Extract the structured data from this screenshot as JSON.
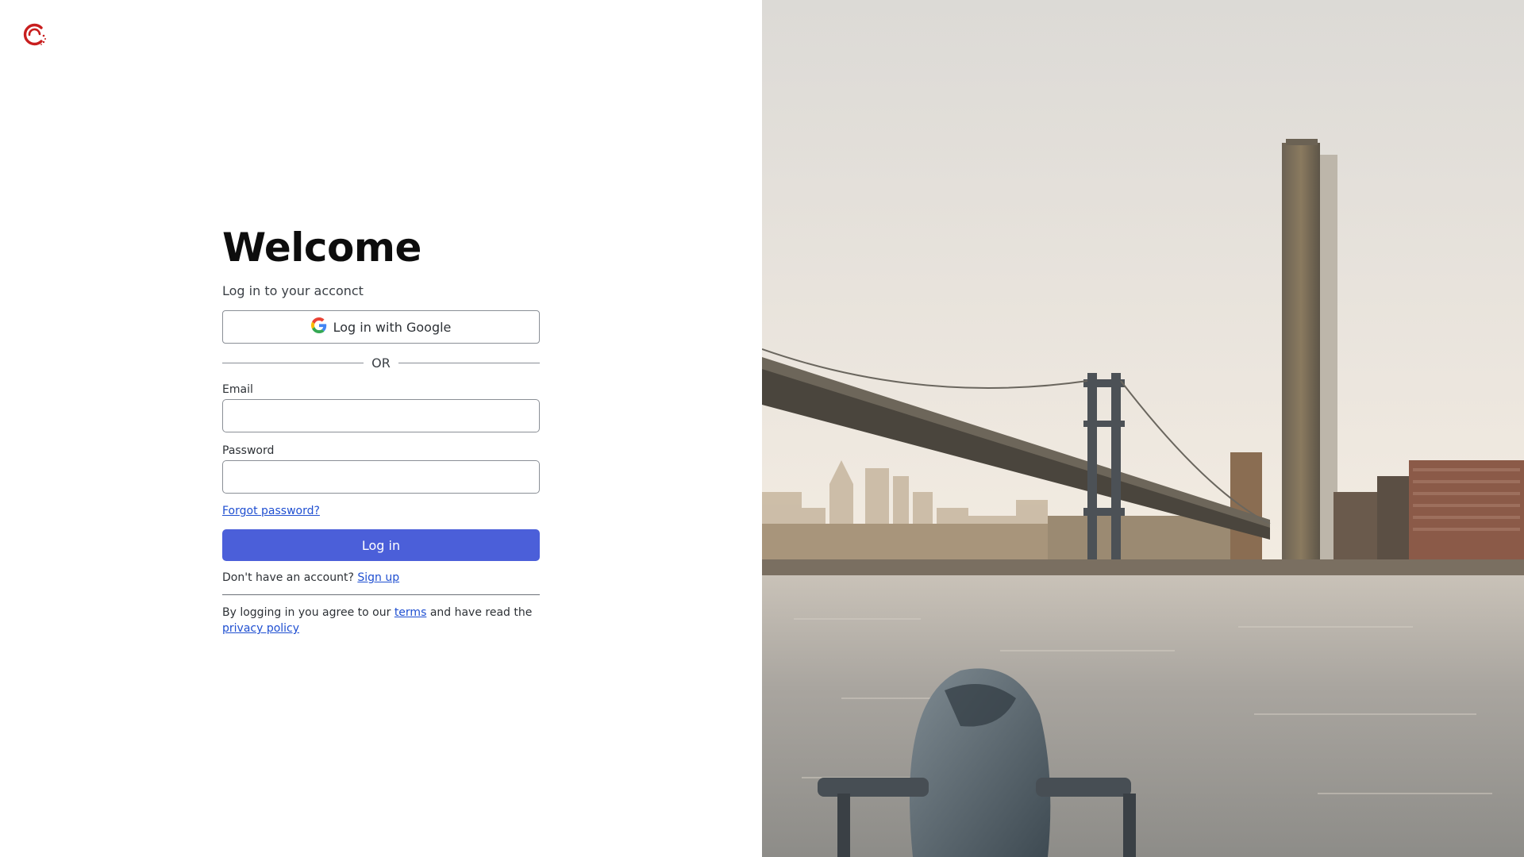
{
  "brand": {
    "logo_icon": "brand-logo-icon",
    "accent": "#c81e1e"
  },
  "header": {
    "title": "Welcome",
    "subtitle": "Log in to your acconct"
  },
  "google_button": {
    "label": "Log in with Google",
    "icon": "google-icon"
  },
  "divider": {
    "label": "OR"
  },
  "email": {
    "label": "Email",
    "value": "",
    "placeholder": ""
  },
  "password": {
    "label": "Password",
    "value": "",
    "placeholder": ""
  },
  "forgot_password": {
    "label": "Forgot password?"
  },
  "login_button": {
    "label": "Log in",
    "color": "#4b5fd9"
  },
  "signup": {
    "prompt": "Don't have an account?",
    "link": "Sign up"
  },
  "legal": {
    "prefix": "By logging in you agree to our",
    "terms_link": "terms",
    "middle": "and have read the",
    "privacy_link": "privacy policy"
  },
  "hero_image": {
    "subject": "city-bridge-photo"
  }
}
